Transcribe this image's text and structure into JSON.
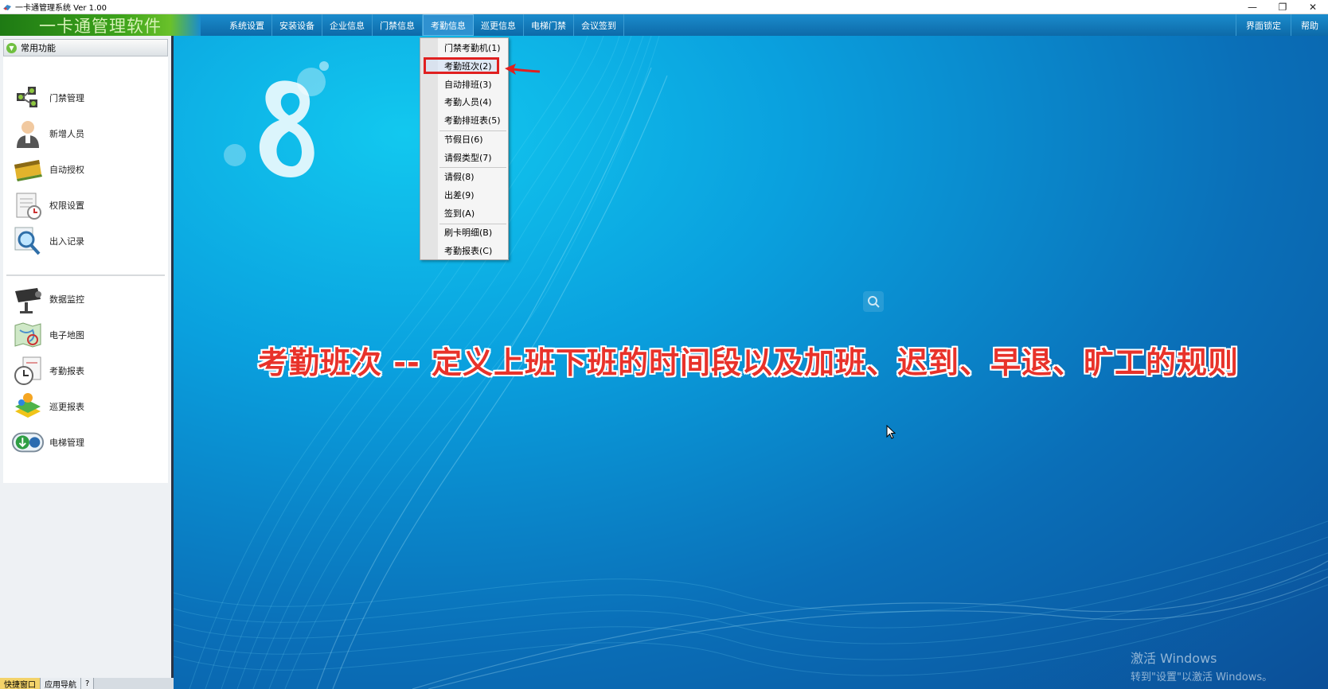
{
  "window": {
    "title": "一卡通管理系统  Ver 1.00",
    "controls": [
      "—",
      "❐",
      "✕"
    ]
  },
  "header": {
    "brand": "一卡通管理软件",
    "menu": [
      "系统设置",
      "安装设备",
      "企业信息",
      "门禁信息",
      "考勤信息",
      "巡更信息",
      "电梯门禁",
      "会议签到"
    ],
    "active_menu": "考勤信息",
    "right_menu": [
      "界面锁定",
      "帮助"
    ]
  },
  "sidebar": {
    "header": "常用功能",
    "items": [
      {
        "label": "门禁管理",
        "icon": "door-access-icon"
      },
      {
        "label": "新增人员",
        "icon": "person-add-icon"
      },
      {
        "label": "自动授权",
        "icon": "card-auth-icon"
      },
      {
        "label": "权限设置",
        "icon": "permission-icon"
      },
      {
        "label": "出入记录",
        "icon": "record-search-icon"
      },
      {
        "label": "数据监控",
        "icon": "camera-monitor-icon"
      },
      {
        "label": "电子地图",
        "icon": "map-icon"
      },
      {
        "label": "考勤报表",
        "icon": "attendance-report-icon"
      },
      {
        "label": "巡更报表",
        "icon": "patrol-report-icon"
      },
      {
        "label": "电梯管理",
        "icon": "elevator-icon"
      }
    ],
    "bottom_tabs": [
      "快捷窗口",
      "应用导航",
      "?"
    ]
  },
  "dropdown": {
    "items": [
      "门禁考勤机(1)",
      "考勤班次(2)",
      "自动排班(3)",
      "考勤人员(4)",
      "考勤排班表(5)",
      "节假日(6)",
      "请假类型(7)",
      "请假(8)",
      "出差(9)",
      "签到(A)",
      "刷卡明细(B)",
      "考勤报表(C)"
    ],
    "highlighted": "考勤班次(2)"
  },
  "caption": "考勤班次 -- 定义上班下班的时间段以及加班、迟到、早退、旷工的规则",
  "watermark": {
    "line1": "激活 Windows",
    "line2": "转到\"设置\"以激活 Windows。"
  },
  "colors": {
    "menu_bar": "#0d6aa8",
    "brand_green": "#3ca21a",
    "caption_red": "#e8322a",
    "highlight_red": "#e02020"
  }
}
